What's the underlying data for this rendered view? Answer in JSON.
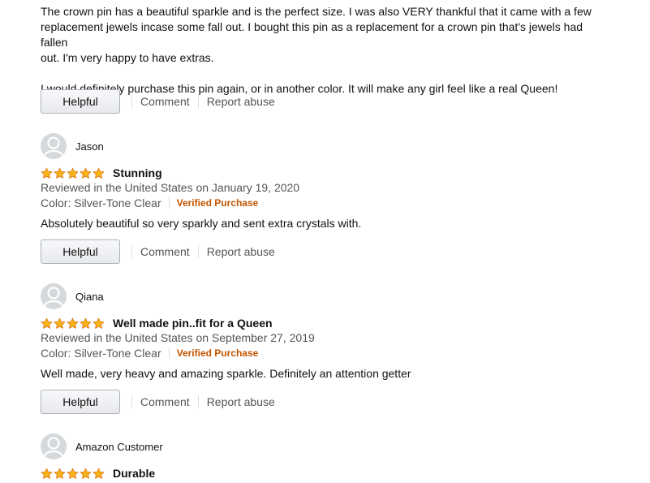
{
  "review0": {
    "body_lines": [
      "The crown pin has a beautiful sparkle and is the perfect size. I was also VERY thankful that it came with a few",
      "replacement jewels incase some fall out. I bought this pin as a replacement for a crown pin that's jewels had fallen",
      "out. I'm very happy to have extras."
    ],
    "body_extra": "I would definitely purchase this pin again, or in another color. It will make any girl feel like a real Queen!"
  },
  "actions": {
    "helpful": "Helpful",
    "comment": "Comment",
    "report": "Report abuse"
  },
  "reviews": [
    {
      "name": "Jason",
      "rating": 5,
      "title": "Stunning",
      "date": "Reviewed in the United States on January 19, 2020",
      "variant": "Color: Silver-Tone Clear",
      "verified": "Verified Purchase",
      "body": "Absolutely beautiful so very sparkly and sent extra crystals with."
    },
    {
      "name": "Qiana",
      "rating": 5,
      "title": "Well made pin..fit for a Queen",
      "date": "Reviewed in the United States on September 27, 2019",
      "variant": "Color: Silver-Tone Clear",
      "verified": "Verified Purchase",
      "body": "Well made, very heavy and amazing sparkle. Definitely an attention getter"
    },
    {
      "name": "Amazon Customer",
      "rating": 5,
      "title": "Durable"
    }
  ],
  "colors": {
    "star_fill": "#f7b416",
    "star_stroke": "#de7921",
    "verified": "#c45500"
  }
}
